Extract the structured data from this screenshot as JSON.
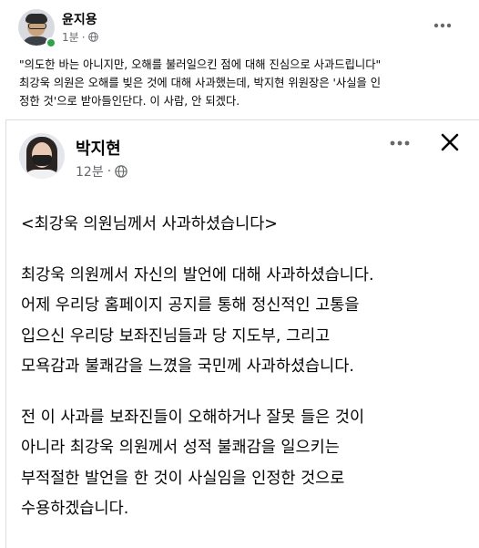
{
  "outer_post": {
    "author": "윤지용",
    "time": "1분",
    "meta_separator": "·",
    "text_line1": "\"의도한 바는 아니지만, 오해를 불러일으킨 점에 대해 진심으로 사과드립니다\"",
    "text_line2": "최강욱 의원은 오해를 빚은 것에 대해 사과했는데, 박지현 위원장은 '사실을 인",
    "text_line3": "정한 것'으로 받아들인단다. 이 사람, 안 되겠다."
  },
  "shared_post": {
    "author": "박지현",
    "time": "12분",
    "meta_separator": "·",
    "body_line1": "<최강욱 의원님께서 사과하셨습니다>",
    "body_line2": "최강욱 의원께서 자신의 발언에 대해 사과하셨습니다.",
    "body_line3": "어제 우리당 홈페이지 공지를 통해 정신적인 고통을",
    "body_line4": "입으신 우리당 보좌진님들과 당 지도부, 그리고",
    "body_line5": "모욕감과 불쾌감을 느꼈을 국민께 사과하셨습니다.",
    "body_line6": "전 이 사과를 보좌진들이 오해하거나 잘못 들은 것이",
    "body_line7": "아니라 최강욱 의원께서 성적 불쾌감을 일으키는",
    "body_line8": "부적절한 발언을 한 것이 사실임을 인정한 것으로",
    "body_line9": "수용하겠습니다."
  },
  "icons": {
    "privacy": "globe-icon",
    "more": "more-horizontal-icon",
    "close": "close-icon"
  },
  "colors": {
    "text": "#050505",
    "secondary_text": "#65676b",
    "online": "#31a24c",
    "divider": "#dadde1"
  }
}
